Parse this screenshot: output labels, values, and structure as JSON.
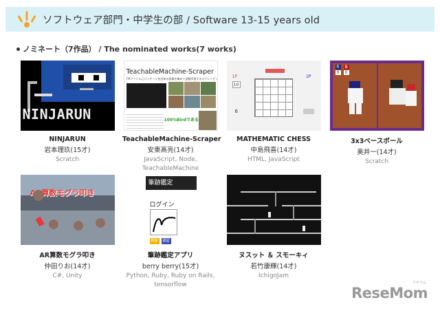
{
  "header": {
    "title": "ソフトウェア部門・中学生の部 / Software 13-15 years old"
  },
  "section": {
    "heading": "ノミネート（7作品） / The nominated works(7 works)"
  },
  "works": [
    {
      "title": "NINJARUN",
      "author": "岩本理玖(15才)",
      "tech": "Scratch",
      "thumb_text": "NINJARUN"
    },
    {
      "title": "TeachableMachine-Scraper",
      "author": "安東髙亮(14才)",
      "tech": "JavaScript, Node, TeachableMachine",
      "thumb_text": "TeachableMachine-Scraper",
      "thumb_sub": "TMファイルにパッケージ化出来る画像を集めて自動学習するスクレイピングツール",
      "thumb_badge": "100%Birdであると判定！"
    },
    {
      "title": "MATHEMATIC CHESS",
      "author": "中島飛喜(14才)",
      "tech": "HTML, JavaScript",
      "thumb_p1": "1P",
      "thumb_p2": "2P",
      "thumb_num": "10",
      "thumb_left_num": "6"
    },
    {
      "title": "3x3ベースボール",
      "author": "奥井一(14才)",
      "tech": "Scratch",
      "thumb_r": "R",
      "thumb_b": "B",
      "thumb_s0": "0",
      "thumb_s1": "0"
    },
    {
      "title": "AR算数モグラ叩き",
      "author": "仲田りお(14才)",
      "tech": "C#, Unity",
      "thumb_text": "AR算数モグラ叩き"
    },
    {
      "title": "筆跡鑑定アプリ",
      "author": "berry berry(15才)",
      "tech": "Python, Ruby, Ruby on Rails, tensorflow",
      "thumb_banner": "筆跡鑑定",
      "thumb_login": "ログイン",
      "thumb_btn1": "削除",
      "thumb_btn2": "認証"
    },
    {
      "title": "ヌスット ＆ スモーキィ",
      "author": "若竹康輝(14才)",
      "tech": "IchigoJam"
    }
  ],
  "logo": {
    "text": "ReseMom",
    "ruby": "リセマム"
  },
  "colors": {
    "header_bg": "#daf0f7",
    "icon_orange": "#f4a623",
    "ninja_blue": "#1f4fa8",
    "baseball_purple": "#6b2b8a"
  }
}
